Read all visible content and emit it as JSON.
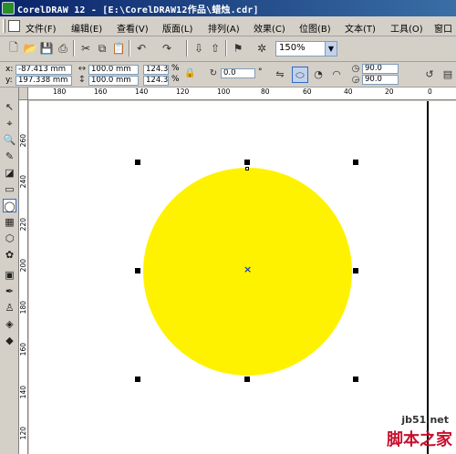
{
  "window": {
    "title": "CorelDRAW 12 - [E:\\CorelDRAW12作品\\蜡烛.cdr]"
  },
  "menu": [
    {
      "label": "文件(F)"
    },
    {
      "label": "编辑(E)"
    },
    {
      "label": "查看(V)"
    },
    {
      "label": "版面(L)"
    },
    {
      "label": "排列(A)"
    },
    {
      "label": "效果(C)"
    },
    {
      "label": "位图(B)"
    },
    {
      "label": "文本(T)"
    },
    {
      "label": "工具(O)"
    },
    {
      "label": "窗口"
    }
  ],
  "toolbar": {
    "zoom": "150%",
    "icons": [
      "new-icon",
      "open-icon",
      "save-icon",
      "print-icon",
      "cut-icon",
      "copy-icon",
      "paste-icon",
      "undo-icon",
      "redo-icon",
      "import-icon",
      "export-icon",
      "app-launcher-icon",
      "corel-online-icon"
    ]
  },
  "property_bar": {
    "x_label": "x:",
    "x_value": "-87.413 mm",
    "y_label": "y:",
    "y_value": "197.338 mm",
    "width_value": "100.0 mm",
    "height_value": "100.0 mm",
    "scale_x": "124.3",
    "scale_y": "124.3",
    "percent": "%",
    "rotation": "0.0",
    "degree": "°",
    "start_angle": "90.0",
    "end_angle": "90.0"
  },
  "ruler": {
    "h_labels": [
      "180",
      "160",
      "140",
      "120",
      "100",
      "80",
      "60",
      "40",
      "20",
      "0"
    ],
    "v_labels": [
      "260",
      "240",
      "220",
      "200",
      "180",
      "160",
      "140",
      "120"
    ]
  },
  "tools": [
    "pick-tool",
    "shape-tool",
    "zoom-tool",
    "freehand-tool",
    "smart-fill-tool",
    "rectangle-tool",
    "ellipse-tool",
    "graph-paper-tool",
    "basic-shapes-tool",
    "text-tool",
    "interactive-blend-tool",
    "eyedropper-tool",
    "outline-tool",
    "fill-tool",
    "interactive-fill-tool"
  ],
  "canvas": {
    "circle_color": "#fff200"
  },
  "watermark": {
    "site": "jb51.net",
    "brand": "脚本之家"
  }
}
